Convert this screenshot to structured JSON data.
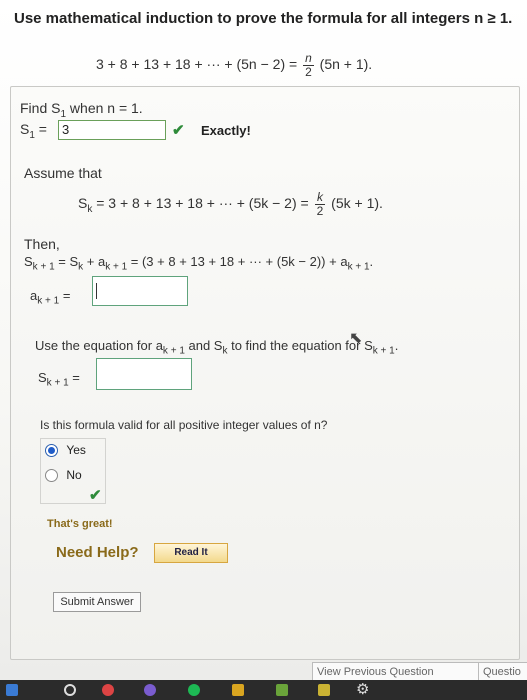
{
  "question": {
    "prompt": "Use mathematical induction to prove the formula for all integers n ≥ 1.",
    "formula_left": "3 + 8 + 13 + 18 + ··· + (5n − 2) =",
    "formula_frac_num": "n",
    "formula_frac_den": "2",
    "formula_right": "(5n + 1)."
  },
  "step1": {
    "find_text": "Find S",
    "find_sub": "1",
    "find_tail": " when n = 1.",
    "s1_label": "S",
    "s1_sub": "1",
    "s1_eq": " =",
    "s1_value": "3",
    "feedback": "Exactly!"
  },
  "assume": {
    "label": "Assume that",
    "left": "S",
    "left_sub": "k",
    "mid": " = 3 + 8 + 13 + 18 + ··· + (5k − 2) =",
    "frac_num": "k",
    "frac_den": "2",
    "right": "(5k + 1)."
  },
  "then": {
    "label": "Then,",
    "lhs": "S",
    "lhs_sub": "k + 1",
    "eq1": " = S",
    "eq1_sub": "k",
    "plus_a": " + a",
    "plus_a_sub": "k + 1",
    "expansion": " = (3 + 8 + 13 + 18 + ··· + (5k − 2)) + a",
    "expansion_sub": "k + 1",
    "expansion_tail": ".",
    "ak1_label": "a",
    "ak1_sub": "k + 1",
    "ak1_eq": " ="
  },
  "use_eq": {
    "text1": "Use the equation for a",
    "sub1": "k + 1",
    "text2": " and S",
    "sub2": "k",
    "text3": " to find the equation for S",
    "sub3": "k + 1",
    "text4": ".",
    "sk1_label": "S",
    "sk1_sub": "k + 1",
    "sk1_eq": " ="
  },
  "valid": {
    "question": "Is this formula valid for all positive integer values of n?",
    "options": [
      "Yes",
      "No"
    ],
    "selected": "Yes",
    "feedback": "That's great!"
  },
  "help": {
    "label": "Need Help?",
    "button": "Read It"
  },
  "submit_label": "Submit Answer",
  "footer": {
    "prev": "View Previous Question",
    "next": "Questio"
  },
  "colors": {
    "accent_check": "#2e8b3a",
    "radio_selected": "#1f5cc8",
    "help_text": "#8a6a1a"
  }
}
